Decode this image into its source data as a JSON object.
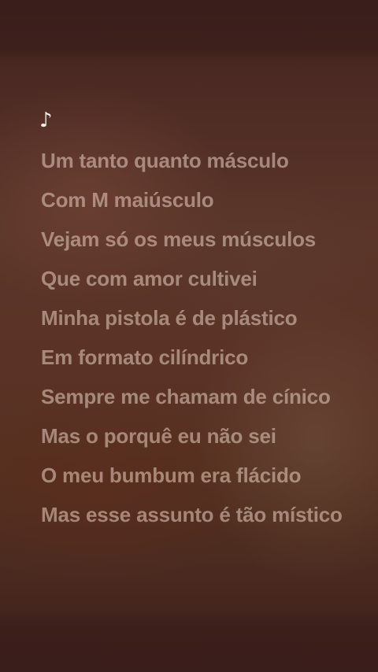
{
  "player": {
    "note_symbol": "♪",
    "lyric_lines": [
      "Um tanto quanto másculo",
      "Com M maiúsculo",
      "Vejam só os meus músculos",
      "Que com amor cultivei",
      "Minha pistola é de plástico",
      "Em formato cilíndrico",
      "Sempre me chamam de cínico",
      "Mas o porquê eu não sei",
      "O meu bumbum era flácido",
      "Mas esse assunto é tão místico"
    ]
  },
  "colors": {
    "background": "#5a3529",
    "text_dimmed": "#d6beb2",
    "note": "#f4efe9"
  }
}
